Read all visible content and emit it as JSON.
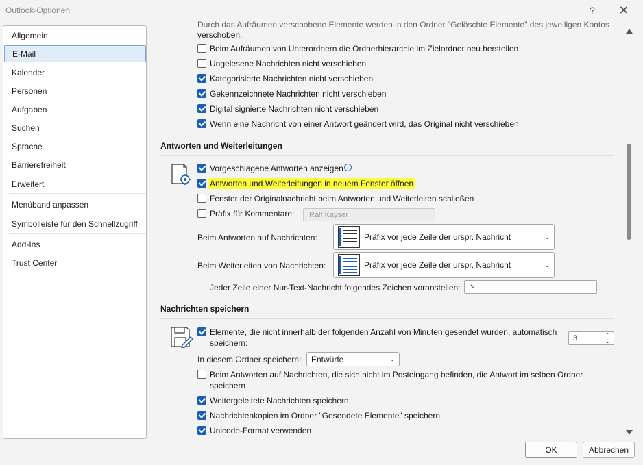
{
  "window": {
    "title": "Outlook-Optionen",
    "help_glyph": "?",
    "close_glyph": "✕"
  },
  "sidebar": {
    "items": [
      {
        "label": "Allgemein"
      },
      {
        "label": "E-Mail"
      },
      {
        "label": "Kalender"
      },
      {
        "label": "Personen"
      },
      {
        "label": "Aufgaben"
      },
      {
        "label": "Suchen"
      },
      {
        "label": "Sprache"
      },
      {
        "label": "Barrierefreiheit"
      },
      {
        "label": "Erweitert"
      },
      {
        "label": "Menüband anpassen"
      },
      {
        "label": "Symbolleiste für den Schnellzugriff"
      },
      {
        "label": "Add-Ins"
      },
      {
        "label": "Trust Center"
      }
    ],
    "active": "E-Mail"
  },
  "cleanup": {
    "top_text_1": "Durch das Aufräumen verschobene Elemente werden in den Ordner \"Gelöschte Elemente\" des jeweiligen Kontos",
    "top_text_2": "verschoben.",
    "options": [
      {
        "label": "Beim Aufräumen von Unterordnern die Ordnerhierarchie im Zielordner neu herstellen",
        "checked": false
      },
      {
        "label": "Ungelesene Nachrichten nicht verschieben",
        "checked": false
      },
      {
        "label": "Kategorisierte Nachrichten nicht verschieben",
        "checked": true
      },
      {
        "label": "Gekennzeichnete Nachrichten nicht verschieben",
        "checked": true
      },
      {
        "label": "Digital signierte Nachrichten nicht verschieben",
        "checked": true
      },
      {
        "label": "Wenn eine Nachricht von einer Antwort geändert wird, das Original nicht verschieben",
        "checked": true
      }
    ]
  },
  "replies": {
    "header": "Antworten und Weiterleitungen",
    "suggested": {
      "label": "Vorgeschlagene Antworten anzeigen",
      "checked": true,
      "info": "i"
    },
    "new_window": {
      "label": "Antworten und Weiterleitungen in neuem Fenster öffnen",
      "checked": true,
      "highlight": "#fdfd3a"
    },
    "close_original": {
      "label": "Fenster der Originalnachricht beim Antworten und Weiterleiten schließen",
      "checked": false
    },
    "prefix": {
      "label": "Präfix für Kommentare:",
      "checked": false,
      "value": "Ralf Kayser"
    },
    "on_reply": {
      "label": "Beim Antworten auf Nachrichten:",
      "value": "Präfix vor jede Zeile der urspr. Nachricht"
    },
    "on_forward": {
      "label": "Beim Weiterleiten von Nachrichten:",
      "value": "Präfix vor jede Zeile der urspr. Nachricht"
    },
    "plain_prefix": {
      "label": "Jeder Zeile einer Nur-Text-Nachricht folgendes Zeichen voranstellen:",
      "value": ">"
    }
  },
  "save": {
    "header": "Nachrichten speichern",
    "autosave": {
      "label_1": "Elemente, die nicht innerhalb der folgenden Anzahl von Minuten gesendet wurden, automatisch",
      "label_2": "speichern:",
      "checked": true,
      "minutes": "3"
    },
    "folder": {
      "label": "In diesem Ordner speichern:",
      "value": "Entwürfe"
    },
    "reply_same_folder": {
      "label_1": "Beim Antworten auf Nachrichten, die sich nicht im Posteingang befinden, die Antwort im selben Ordner",
      "label_2": "speichern",
      "checked": false
    },
    "forwarded": {
      "label": "Weitergeleitete Nachrichten speichern",
      "checked": true
    },
    "copies": {
      "label": "Nachrichtenkopien im Ordner \"Gesendete Elemente\" speichern",
      "checked": true
    },
    "unicode": {
      "label": "Unicode-Format verwenden",
      "checked": true
    }
  },
  "buttons": {
    "ok": "OK",
    "cancel": "Abbrechen"
  },
  "colors": {
    "accent": "#1d5fb4",
    "selection": "#e1ecf9"
  }
}
